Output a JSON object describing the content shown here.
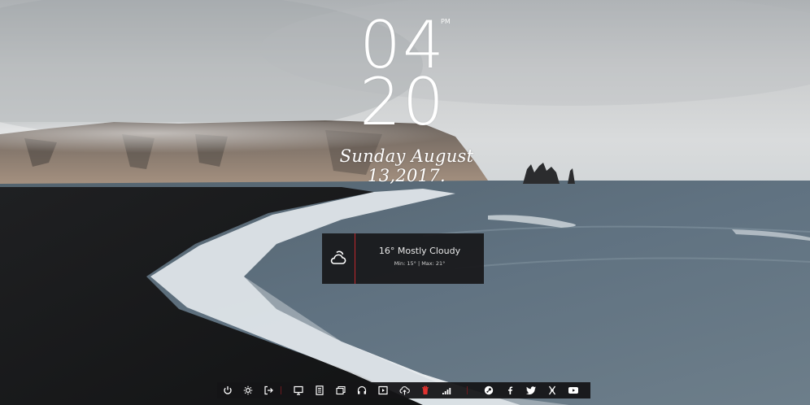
{
  "clock": {
    "hour": "04",
    "minute": "20",
    "ampm": "PM",
    "date": "Sunday August 13,2017."
  },
  "weather": {
    "icon": "cloud-sun-icon",
    "summary": "16° Mostly Cloudy",
    "minmax": "Min: 15° | Max: 21°"
  },
  "taskbar": {
    "items": [
      {
        "icon": "power-icon"
      },
      {
        "icon": "settings-gear-icon"
      },
      {
        "icon": "logout-icon"
      },
      {
        "icon": "monitor-icon"
      },
      {
        "icon": "document-icon"
      },
      {
        "icon": "folders-icon"
      },
      {
        "icon": "headphones-icon"
      },
      {
        "icon": "media-player-icon"
      },
      {
        "icon": "cloud-upload-icon"
      },
      {
        "icon": "trash-icon"
      },
      {
        "icon": "signal-bars-icon"
      },
      {
        "icon": "steam-icon"
      },
      {
        "icon": "facebook-icon"
      },
      {
        "icon": "twitter-icon"
      },
      {
        "icon": "xda-icon"
      },
      {
        "icon": "youtube-icon"
      }
    ]
  },
  "colors": {
    "accent": "#c0272d",
    "panel": "#18181a",
    "text": "#ffffff"
  }
}
